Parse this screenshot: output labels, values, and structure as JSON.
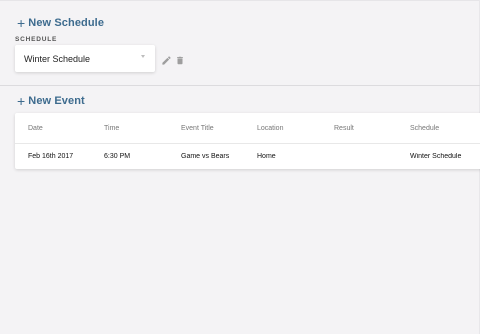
{
  "schedule_section": {
    "add_label": "New Schedule",
    "field_label": "SCHEDULE",
    "selected": "Winter Schedule"
  },
  "event_section": {
    "add_label": "New Event",
    "columns": [
      "Date",
      "Time",
      "Event Title",
      "Location",
      "Result",
      "Schedule"
    ],
    "rows": [
      {
        "date": "Feb 16th 2017",
        "time": "6:30 PM",
        "title": "Game vs Bears",
        "location": "Home",
        "result": "",
        "schedule": "Winter Schedule"
      }
    ]
  },
  "colors": {
    "accent": "#3d6b8e",
    "background": "#f4f3f5",
    "card": "#ffffff",
    "icon": "#9e9e9e"
  },
  "icons": {
    "add": "plus-icon",
    "edit": "pencil-icon",
    "delete": "trash-icon",
    "dropdown": "chevron-down-icon"
  }
}
